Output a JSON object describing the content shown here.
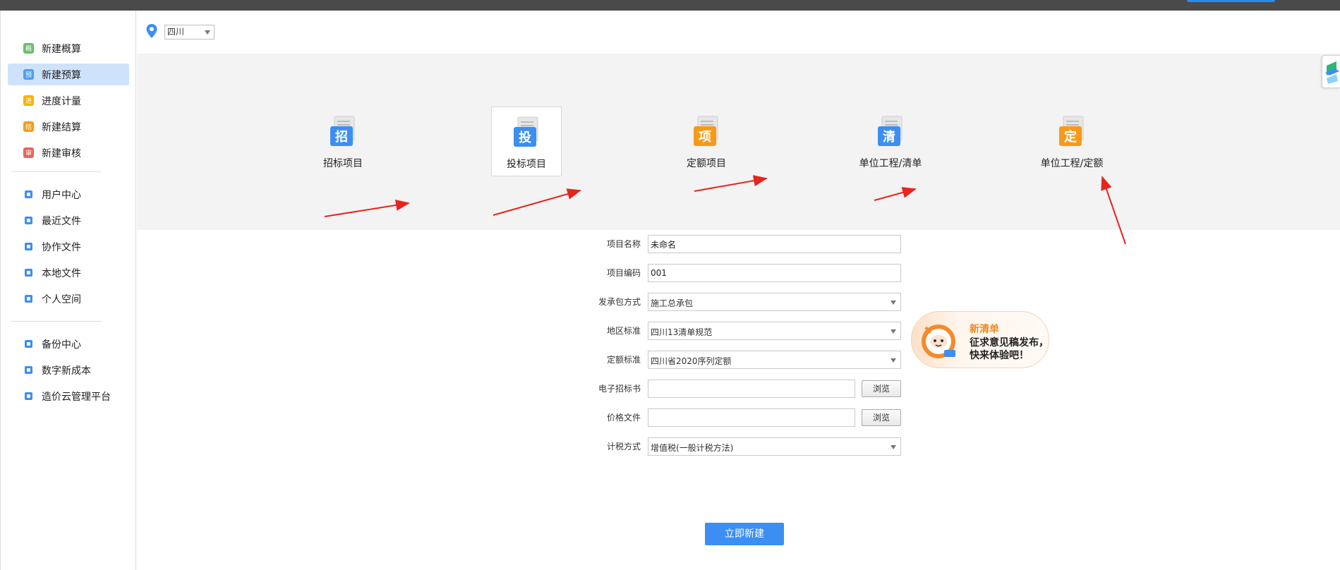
{
  "region": {
    "selected": "四川"
  },
  "sidebar": {
    "group1": [
      {
        "label": "新建概算",
        "glyph": "概",
        "color": "#6cbf6a",
        "icon": "budget-estimate-icon"
      },
      {
        "label": "新建预算",
        "glyph": "预",
        "color": "#4f9df5",
        "icon": "budget-icon",
        "active": true
      },
      {
        "label": "进度计量",
        "glyph": "进",
        "color": "#f5b400",
        "icon": "progress-icon"
      },
      {
        "label": "新建结算",
        "glyph": "结",
        "color": "#f59b1a",
        "icon": "settlement-icon"
      },
      {
        "label": "新建审核",
        "glyph": "审",
        "color": "#f0645a",
        "icon": "audit-icon"
      }
    ],
    "group2": [
      {
        "label": "用户中心",
        "icon": "user-icon"
      },
      {
        "label": "最近文件",
        "icon": "recent-files-icon"
      },
      {
        "label": "协作文件",
        "icon": "collaboration-icon"
      },
      {
        "label": "本地文件",
        "icon": "local-files-icon"
      },
      {
        "label": "个人空间",
        "icon": "personal-space-icon"
      }
    ],
    "group3": [
      {
        "label": "备份中心",
        "icon": "backup-icon"
      },
      {
        "label": "数字新成本",
        "icon": "digital-cost-icon"
      },
      {
        "label": "造价云管理平台",
        "icon": "cloud-platform-icon"
      }
    ]
  },
  "project_types": [
    {
      "label": "招标项目",
      "glyph": "招",
      "color": "#3d8ef0",
      "icon": "bid-invite-icon"
    },
    {
      "label": "投标项目",
      "glyph": "投",
      "color": "#3d8ef0",
      "icon": "bid-submit-icon",
      "selected": true
    },
    {
      "label": "定额项目",
      "glyph": "项",
      "color": "#f59b1a",
      "icon": "quota-project-icon"
    },
    {
      "label": "单位工程/清单",
      "glyph": "清",
      "color": "#3d8ef0",
      "icon": "unit-bill-icon"
    },
    {
      "label": "单位工程/定额",
      "glyph": "定",
      "color": "#f59b1a",
      "icon": "unit-quota-icon"
    }
  ],
  "form": {
    "project_name": {
      "label": "项目名称",
      "value": "未命名"
    },
    "project_code": {
      "label": "项目编码",
      "value": "001"
    },
    "contract_mode": {
      "label": "发承包方式",
      "value": "施工总承包"
    },
    "region_standard": {
      "label": "地区标准",
      "value": "四川13清单规范"
    },
    "quota_standard": {
      "label": "定额标准",
      "value": "四川省2020序列定额"
    },
    "tender_doc": {
      "label": "电子招标书",
      "value": "",
      "button": "浏览"
    },
    "price_file": {
      "label": "价格文件",
      "value": "",
      "button": "浏览"
    },
    "tax_mode": {
      "label": "计税方式",
      "value": "增值税(一般计税方法)"
    }
  },
  "promo": {
    "title": "新清单",
    "line1": "征求意见稿发布，",
    "line2": "快来体验吧！"
  },
  "create_button": "立即新建",
  "colors": {
    "accent": "#3c8ef3",
    "arrow": "#e8241c",
    "active_bg": "#cfe2fb"
  }
}
